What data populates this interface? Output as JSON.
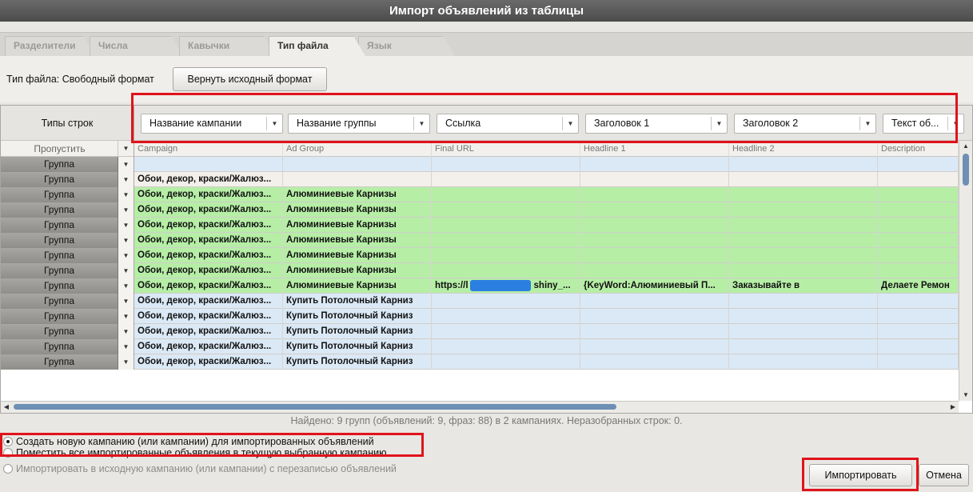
{
  "window": {
    "title": "Импорт объявлений из таблицы"
  },
  "tabs": [
    {
      "label": "Разделители",
      "active": false
    },
    {
      "label": "Числа",
      "active": false
    },
    {
      "label": "Кавычки",
      "active": false
    },
    {
      "label": "Тип файла",
      "active": true
    },
    {
      "label": "Язык",
      "active": false
    }
  ],
  "filetype": {
    "label": "Тип файла: Свободный формат",
    "revert_button": "Вернуть исходный формат"
  },
  "grid": {
    "row_types_header": "Типы строк",
    "skip_label": "Пропустить",
    "columns": [
      {
        "mapping": "Название кампании",
        "source": "Campaign"
      },
      {
        "mapping": "Название группы",
        "source": "Ad Group"
      },
      {
        "mapping": "Ссылка",
        "source": "Final URL"
      },
      {
        "mapping": "Заголовок 1",
        "source": "Headline 1"
      },
      {
        "mapping": "Заголовок 2",
        "source": "Headline 2"
      },
      {
        "mapping": "Текст об...",
        "source": "Description"
      }
    ],
    "rows": [
      {
        "type": "Группа",
        "bg": "blue",
        "cells": [
          "",
          "",
          "",
          "",
          "",
          ""
        ]
      },
      {
        "type": "Группа",
        "bg": "beige",
        "cells": [
          "Обои, декор, краски/Жалюз...",
          "",
          "",
          "",
          "",
          ""
        ]
      },
      {
        "type": "Группа",
        "bg": "green",
        "cells": [
          "Обои, декор, краски/Жалюз...",
          "Алюминиевые Карнизы",
          "",
          "",
          "",
          ""
        ]
      },
      {
        "type": "Группа",
        "bg": "green",
        "cells": [
          "Обои, декор, краски/Жалюз...",
          "Алюминиевые Карнизы",
          "",
          "",
          "",
          ""
        ]
      },
      {
        "type": "Группа",
        "bg": "green",
        "cells": [
          "Обои, декор, краски/Жалюз...",
          "Алюминиевые Карнизы",
          "",
          "",
          "",
          ""
        ]
      },
      {
        "type": "Группа",
        "bg": "green",
        "cells": [
          "Обои, декор, краски/Жалюз...",
          "Алюминиевые Карнизы",
          "",
          "",
          "",
          ""
        ]
      },
      {
        "type": "Группа",
        "bg": "green",
        "cells": [
          "Обои, декор, краски/Жалюз...",
          "Алюминиевые Карнизы",
          "",
          "",
          "",
          ""
        ]
      },
      {
        "type": "Группа",
        "bg": "green",
        "cells": [
          "Обои, декор, краски/Жалюз...",
          "Алюминиевые Карнизы",
          "",
          "",
          "",
          ""
        ]
      },
      {
        "type": "Группа",
        "bg": "green",
        "cells": [
          "Обои, декор, краски/Жалюз...",
          "Алюминиевые Карнизы",
          "https://l",
          "{KeyWord:Алюминиевый П...",
          "Заказывайте в",
          "Делаете Ремон"
        ],
        "url_tail": "shiny_..."
      },
      {
        "type": "Группа",
        "bg": "blue",
        "cells": [
          "Обои, декор, краски/Жалюз...",
          "Купить Потолочный Карниз",
          "",
          "",
          "",
          ""
        ]
      },
      {
        "type": "Группа",
        "bg": "blue",
        "cells": [
          "Обои, декор, краски/Жалюз...",
          "Купить Потолочный Карниз",
          "",
          "",
          "",
          ""
        ]
      },
      {
        "type": "Группа",
        "bg": "blue",
        "cells": [
          "Обои, декор, краски/Жалюз...",
          "Купить Потолочный Карниз",
          "",
          "",
          "",
          ""
        ]
      },
      {
        "type": "Группа",
        "bg": "blue",
        "cells": [
          "Обои, декор, краски/Жалюз...",
          "Купить Потолочный Карниз",
          "",
          "",
          "",
          ""
        ]
      },
      {
        "type": "Группа",
        "bg": "blue",
        "cells": [
          "Обои, декор, краски/Жалюз...",
          "Купить Потолочный Карниз",
          "",
          "",
          "",
          ""
        ]
      }
    ]
  },
  "status": "Найдено: 9 групп (объявлений: 9, фраз: 88) в 2 кампаниях. Неразобранных строк: 0.",
  "options": [
    {
      "label": "Создать новую кампанию (или кампании) для импортированных объявлений",
      "checked": true,
      "disabled": false
    },
    {
      "label": "Поместить все импортированные объявления в текущую выбранную кампанию",
      "checked": false,
      "disabled": false
    },
    {
      "label": "Импортировать в исходную кампанию (или кампании) с перезаписью объявлений",
      "checked": false,
      "disabled": true
    }
  ],
  "buttons": {
    "import": "Импортировать",
    "cancel": "Отмена"
  },
  "icons": {
    "dropdown": "chevron-down-icon",
    "redacted": "redaction-bar"
  },
  "colors": {
    "highlight": "#e0131b",
    "row_green": "#b6eea6",
    "row_blue": "#dbe9f6",
    "redaction": "#2b7fe0"
  }
}
